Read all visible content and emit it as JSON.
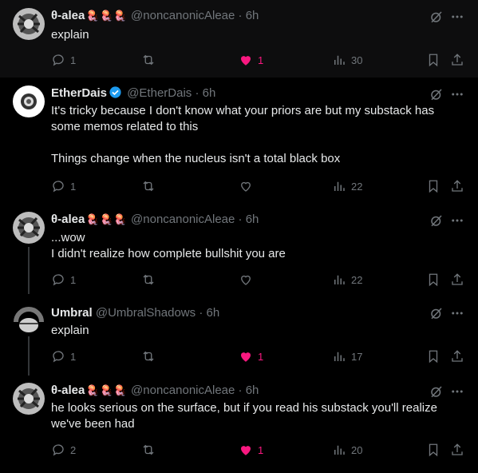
{
  "colors": {
    "background": "#000000",
    "text": "#e7e9ea",
    "muted": "#71767b",
    "like": "#f91880",
    "verified": "#1d9bf0"
  },
  "tweets": [
    {
      "name": "θ-alea",
      "emoji": "🪼🪼🪼",
      "handle": "@noncanonicAleae",
      "dot": "·",
      "time": "6h",
      "lines": [
        "explain"
      ],
      "replies": "1",
      "likes": "1",
      "views": "30",
      "liked": true
    },
    {
      "name": "EtherDais",
      "verified": true,
      "handle": "@EtherDais",
      "dot": "·",
      "time": "6h",
      "lines": [
        "It's tricky because I don't know what your priors are but my substack has",
        "some memos related to this",
        "",
        "Things change when the nucleus isn't a total black box"
      ],
      "replies": "1",
      "likes": "",
      "views": "22",
      "liked": false
    },
    {
      "name": "θ-alea",
      "emoji": "🪼🪼🪼",
      "handle": "@noncanonicAleae",
      "dot": "·",
      "time": "6h",
      "lines": [
        "...wow",
        "I didn't realize how complete bullshit you are"
      ],
      "replies": "1",
      "likes": "",
      "views": "22",
      "liked": false
    },
    {
      "name": "Umbral",
      "handle": "@UmbralShadows",
      "dot": "·",
      "time": "6h",
      "lines": [
        "explain"
      ],
      "replies": "1",
      "likes": "1",
      "views": "17",
      "liked": true
    },
    {
      "name": "θ-alea",
      "emoji": "🪼🪼🪼",
      "handle": "@noncanonicAleae",
      "dot": "·",
      "time": "6h",
      "lines": [
        "he looks serious on the surface, but if you read his substack you'll realize",
        "we've been had"
      ],
      "replies": "2",
      "likes": "1",
      "views": "20",
      "liked": true
    }
  ]
}
